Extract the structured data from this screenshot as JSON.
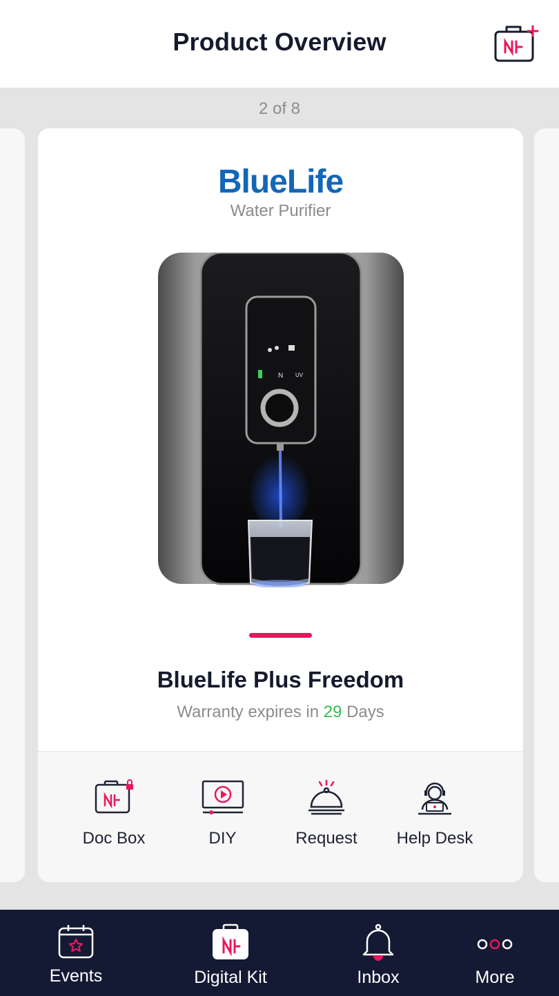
{
  "header": {
    "title": "Product Overview"
  },
  "pager": {
    "text": "2 of 8"
  },
  "card": {
    "brand": "BlueLife",
    "brand_subtitle": "Water Purifier",
    "product_name": "BlueLife Plus Freedom",
    "warranty_prefix": "Warranty expires in ",
    "warranty_days": "29",
    "warranty_suffix": " Days"
  },
  "actions": [
    {
      "label": "Doc Box",
      "icon": "doc-box-lock-icon"
    },
    {
      "label": "DIY",
      "icon": "video-play-icon"
    },
    {
      "label": "Request",
      "icon": "service-bell-icon"
    },
    {
      "label": "Help Desk",
      "icon": "support-agent-icon"
    }
  ],
  "tabs": [
    {
      "label": "Events",
      "icon": "calendar-star-icon"
    },
    {
      "label": "Digital Kit",
      "icon": "digital-kit-icon"
    },
    {
      "label": "Inbox",
      "icon": "bell-icon"
    },
    {
      "label": "More",
      "icon": "more-dots-icon"
    }
  ],
  "colors": {
    "accent": "#e8175d",
    "brand_blue": "#1366b8",
    "tabbar_bg": "#141a33",
    "days_green": "#2fbf4f"
  }
}
